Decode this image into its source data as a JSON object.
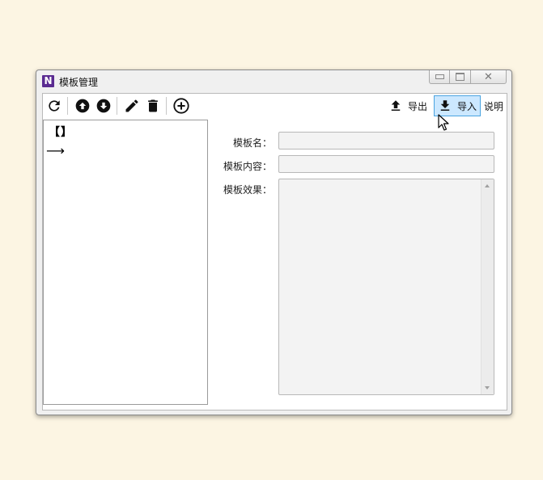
{
  "window": {
    "title": "模板管理",
    "app_icon": "N",
    "controls": {
      "close_glyph": "✕"
    }
  },
  "toolbar": {
    "icons": [
      "refresh-icon",
      "up-circle-icon",
      "down-circle-icon",
      "pencil-icon",
      "trash-icon",
      "add-circle-icon"
    ],
    "export_label": "导出",
    "import_label": "导入",
    "help_label": "说明"
  },
  "tree": {
    "items": [
      "【】",
      "⟶"
    ]
  },
  "form": {
    "name_label": "模板名：",
    "name_value": "",
    "content_label": "模板内容：",
    "content_value": "",
    "effect_label": "模板效果：",
    "effect_value": ""
  },
  "colors": {
    "background": "#fcf5e3",
    "window": "#f0f0f0",
    "active_button": "#cce8ff",
    "active_border": "#4aa3e0",
    "app_icon": "#5a2b91"
  }
}
